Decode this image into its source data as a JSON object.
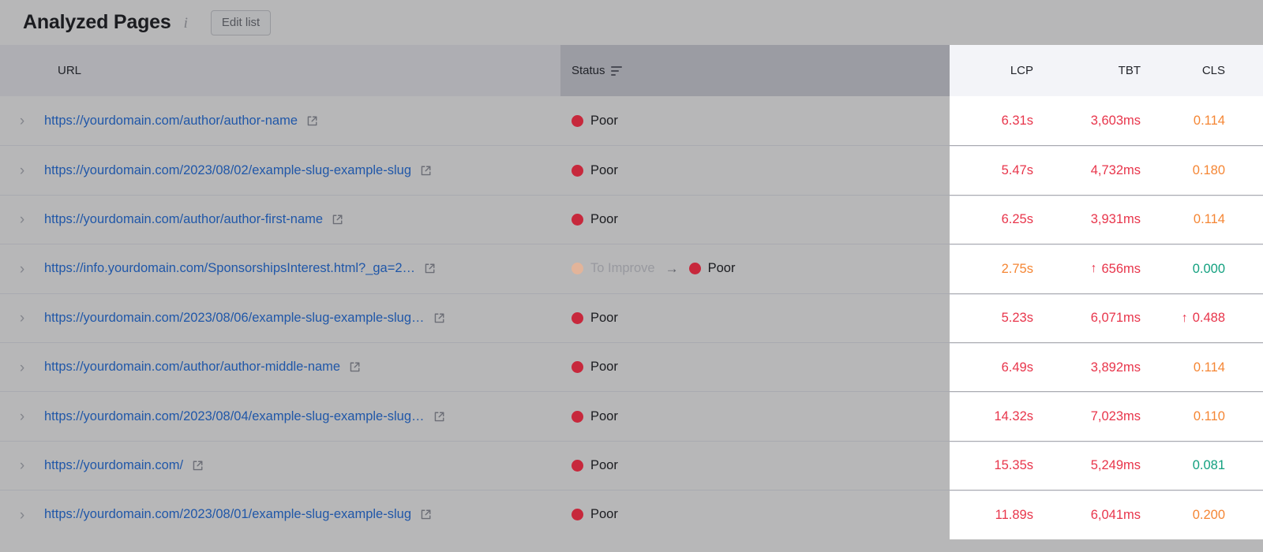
{
  "header": {
    "title": "Analyzed Pages",
    "info_icon": "info-icon",
    "edit_list_label": "Edit list"
  },
  "table": {
    "columns": {
      "url": "URL",
      "status": "Status",
      "lcp": "LCP",
      "tbt": "TBT",
      "cls": "CLS"
    },
    "status_filter_icon": "filter-icon",
    "rows": [
      {
        "url": "https://yourdomain.com/author/author-name",
        "status_prev": "",
        "status": "Poor",
        "lcp": "6.31s",
        "lcp_color": "red",
        "lcp_arrow": "",
        "tbt": "3,603ms",
        "tbt_color": "red",
        "tbt_arrow": "",
        "cls": "0.114",
        "cls_color": "orange",
        "cls_arrow": ""
      },
      {
        "url": "https://yourdomain.com/2023/08/02/example-slug-example-slug",
        "status_prev": "",
        "status": "Poor",
        "lcp": "5.47s",
        "lcp_color": "red",
        "lcp_arrow": "",
        "tbt": "4,732ms",
        "tbt_color": "red",
        "tbt_arrow": "",
        "cls": "0.180",
        "cls_color": "orange",
        "cls_arrow": ""
      },
      {
        "url": "https://yourdomain.com/author/author-first-name",
        "status_prev": "",
        "status": "Poor",
        "lcp": "6.25s",
        "lcp_color": "red",
        "lcp_arrow": "",
        "tbt": "3,931ms",
        "tbt_color": "red",
        "tbt_arrow": "",
        "cls": "0.114",
        "cls_color": "orange",
        "cls_arrow": ""
      },
      {
        "url": "https://info.yourdomain.com/SponsorshipsInterest.html?_ga=2…",
        "status_prev": "To Improve",
        "status": "Poor",
        "lcp": "2.75s",
        "lcp_color": "orange",
        "lcp_arrow": "",
        "tbt": "656ms",
        "tbt_color": "red",
        "tbt_arrow": "↑",
        "cls": "0.000",
        "cls_color": "green",
        "cls_arrow": ""
      },
      {
        "url": "https://yourdomain.com/2023/08/06/example-slug-example-slug…",
        "status_prev": "",
        "status": "Poor",
        "lcp": "5.23s",
        "lcp_color": "red",
        "lcp_arrow": "",
        "tbt": "6,071ms",
        "tbt_color": "red",
        "tbt_arrow": "",
        "cls": "0.488",
        "cls_color": "red",
        "cls_arrow": "↑"
      },
      {
        "url": "https://yourdomain.com/author/author-middle-name",
        "status_prev": "",
        "status": "Poor",
        "lcp": "6.49s",
        "lcp_color": "red",
        "lcp_arrow": "",
        "tbt": "3,892ms",
        "tbt_color": "red",
        "tbt_arrow": "",
        "cls": "0.114",
        "cls_color": "orange",
        "cls_arrow": ""
      },
      {
        "url": "https://yourdomain.com/2023/08/04/example-slug-example-slug…",
        "status_prev": "",
        "status": "Poor",
        "lcp": "14.32s",
        "lcp_color": "red",
        "lcp_arrow": "",
        "tbt": "7,023ms",
        "tbt_color": "red",
        "tbt_arrow": "",
        "cls": "0.110",
        "cls_color": "orange",
        "cls_arrow": ""
      },
      {
        "url": "https://yourdomain.com/",
        "status_prev": "",
        "status": "Poor",
        "lcp": "15.35s",
        "lcp_color": "red",
        "lcp_arrow": "",
        "tbt": "5,249ms",
        "tbt_color": "red",
        "tbt_arrow": "",
        "cls": "0.081",
        "cls_color": "green",
        "cls_arrow": ""
      },
      {
        "url": "https://yourdomain.com/2023/08/01/example-slug-example-slug",
        "status_prev": "",
        "status": "Poor",
        "lcp": "11.89s",
        "lcp_color": "red",
        "lcp_arrow": "",
        "tbt": "6,041ms",
        "tbt_color": "red",
        "tbt_arrow": "",
        "cls": "0.200",
        "cls_color": "orange",
        "cls_arrow": ""
      }
    ],
    "chevron_glyph": "›",
    "arrow_glyph": "→"
  },
  "colors": {
    "red": "#e8354b",
    "orange": "#f58634",
    "green": "#12a07f",
    "link": "#2057a8",
    "poor_dot": "#c7283c",
    "improve_dot_faded": "#e2b49a"
  }
}
